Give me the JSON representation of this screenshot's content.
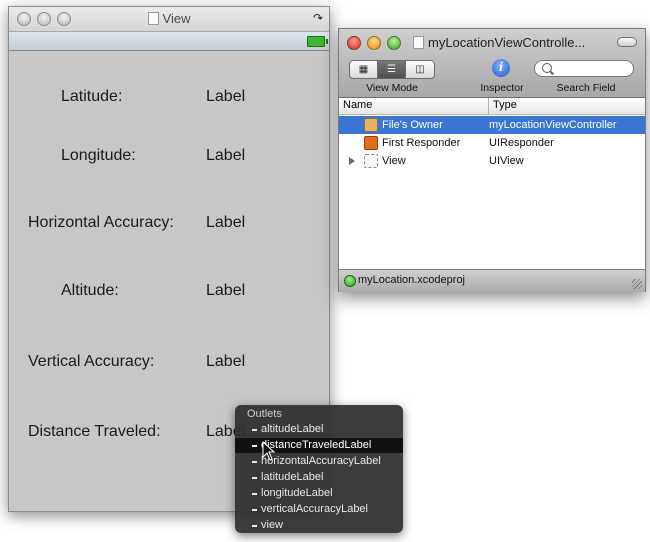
{
  "view_window": {
    "title": "View",
    "rows": [
      {
        "label": "Latitude:",
        "value": "Label"
      },
      {
        "label": "Longitude:",
        "value": "Label"
      },
      {
        "label": "Horizontal Accuracy:",
        "value": "Label"
      },
      {
        "label": "Altitude:",
        "value": "Label"
      },
      {
        "label": "Vertical Accuracy:",
        "value": "Label"
      },
      {
        "label": "Distance Traveled:",
        "value": "Label"
      }
    ]
  },
  "outlets_popup": {
    "heading": "Outlets",
    "items": [
      "altitudeLabel",
      "distanceTraveledLabel",
      "horizontalAccuracyLabel",
      "latitudeLabel",
      "longitudeLabel",
      "verticalAccuracyLabel",
      "view"
    ],
    "selected": "distanceTraveledLabel"
  },
  "doc_window": {
    "title": "myLocationViewControlle...",
    "toolbar": {
      "view_mode_label": "View Mode",
      "inspector_label": "Inspector",
      "search_label": "Search Field",
      "view_modes": [
        "icon-view",
        "list-view",
        "column-view"
      ],
      "active_view_mode": "list-view"
    },
    "columns": {
      "name": "Name",
      "type": "Type"
    },
    "rows": [
      {
        "name": "File's Owner",
        "type": "myLocationViewController",
        "icon": "files-owner-icon",
        "selected": true
      },
      {
        "name": "First Responder",
        "type": "UIResponder",
        "icon": "first-responder-icon",
        "selected": false
      },
      {
        "name": "View",
        "type": "UIView",
        "icon": "uiview-icon",
        "selected": false
      }
    ],
    "project": "myLocation.xcodeproj"
  },
  "colors": {
    "selection": "#3b75d4",
    "view_background": "#c7c7c7",
    "popup_background": "#303030"
  }
}
